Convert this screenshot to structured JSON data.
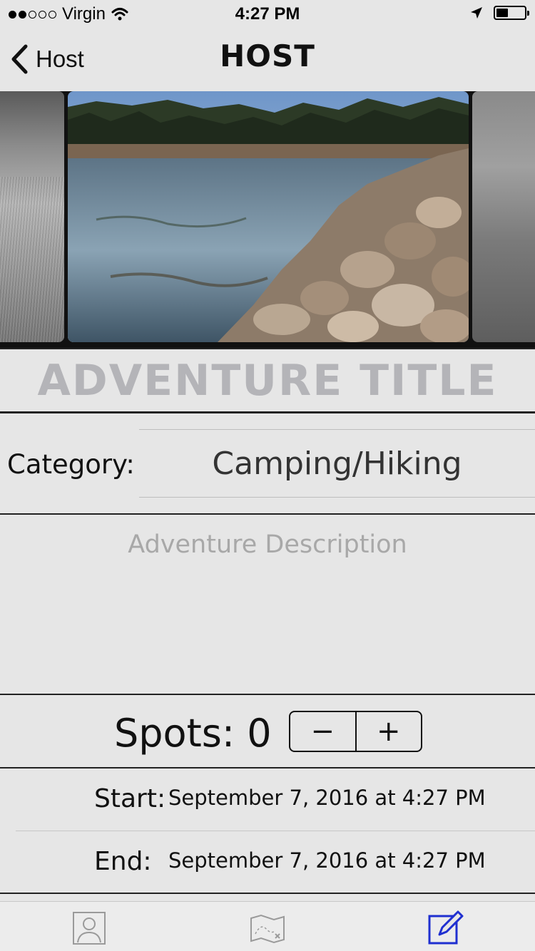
{
  "status_bar": {
    "carrier": "Virgin",
    "time": "4:27 PM",
    "signal_bars_filled": 2,
    "signal_bars_total": 5,
    "icons": [
      "wifi-icon",
      "location-arrow-icon",
      "battery-icon"
    ]
  },
  "nav": {
    "back_label": "Host",
    "title": "HOST",
    "icons": [
      "chevron-left-icon"
    ]
  },
  "gallery": {
    "images": [
      "grayscale-grass-photo",
      "coastal-lake-rocks-photo",
      "grayscale-water-photo"
    ]
  },
  "form": {
    "title_placeholder": "ADVENTURE TITLE",
    "category_label": "Category:",
    "category_value": "Camping/Hiking",
    "description_placeholder": "Adventure Description",
    "spots_text": "Spots: 0",
    "spots_value": 0,
    "stepper_minus": "−",
    "stepper_plus": "+",
    "start_label": "Start:",
    "start_value": "September 7, 2016 at 4:27 PM",
    "end_label": "End:",
    "end_value": "September 7, 2016 at 4:27 PM"
  },
  "tab_bar": {
    "tabs": [
      {
        "icon": "profile-icon",
        "active": false
      },
      {
        "icon": "treasure-map-icon",
        "active": false
      },
      {
        "icon": "compose-icon",
        "active": true
      }
    ],
    "active_color": "#1f2fd0",
    "inactive_color": "#9a9a9a"
  }
}
